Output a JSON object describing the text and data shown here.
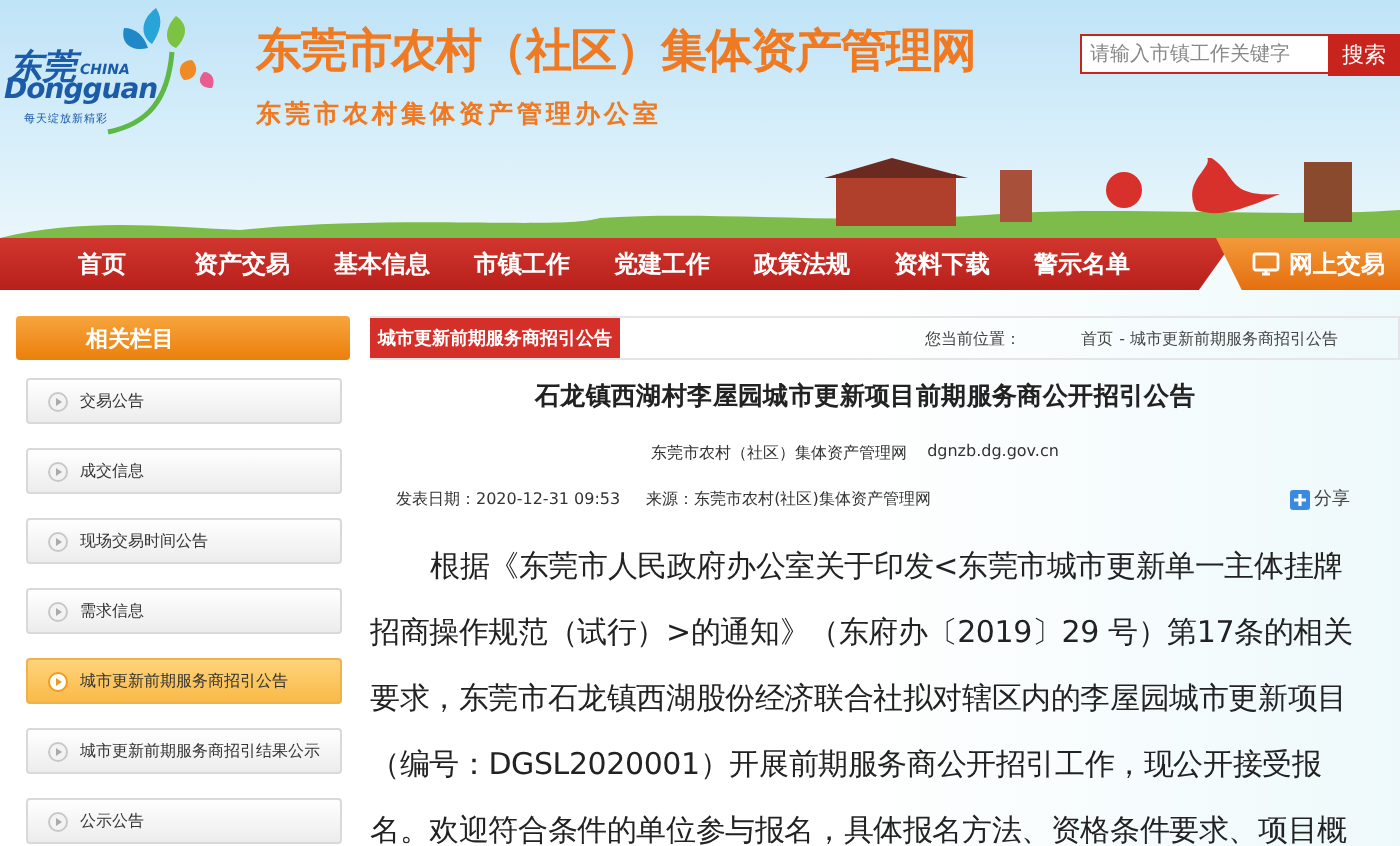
{
  "header": {
    "logo": {
      "cn": "东莞",
      "en_small": "CHINA",
      "en": "Dongguan",
      "slogan": "每天绽放新精彩"
    },
    "title": "东莞市农村（社区）集体资产管理网",
    "subtitle": "东莞市农村集体资产管理办公室",
    "search": {
      "placeholder": "请输入市镇工作关键字",
      "button": "搜索"
    }
  },
  "nav": {
    "items": [
      "首页",
      "资产交易",
      "基本信息",
      "市镇工作",
      "党建工作",
      "政策法规",
      "资料下载",
      "警示名单"
    ],
    "special": "网上交易"
  },
  "sidebar": {
    "title": "相关栏目",
    "items": [
      {
        "label": "交易公告",
        "selected": false
      },
      {
        "label": "成交信息",
        "selected": false
      },
      {
        "label": "现场交易时间公告",
        "selected": false
      },
      {
        "label": "需求信息",
        "selected": false
      },
      {
        "label": "城市更新前期服务商招引公告",
        "selected": true
      },
      {
        "label": "城市更新前期服务商招引结果公示",
        "selected": false
      },
      {
        "label": "公示公告",
        "selected": false
      }
    ]
  },
  "content": {
    "tab": "城市更新前期服务商招引公告",
    "breadcrumb": {
      "prefix": "您当前位置：",
      "home": "首页",
      "rest": "- 城市更新前期服务商招引公告"
    },
    "title": "石龙镇西湖村李屋园城市更新项目前期服务商公开招引公告",
    "source_line": {
      "site": "东莞市农村（社区）集体资产管理网",
      "url": "dgnzb.dg.gov.cn"
    },
    "date": "发表日期：2020-12-31 09:53",
    "origin": "来源：东莞市农村(社区)集体资产管理网",
    "share": "分享",
    "body": "根据《东莞市人民政府办公室关于印发<东莞市城市更新单一主体挂牌招商操作规范（试行）>的通知》（东府办〔2019〕29 号）第17条的相关要求，东莞市石龙镇西湖股份经济联合社拟对辖区内的李屋园城市更新项目（编号：DGSL2020001）开展前期服务商公开招引工作，现公开接受报名。欢迎符合条件的单位参与报名，具体报名方法、资格条件要求、项目概"
  }
}
